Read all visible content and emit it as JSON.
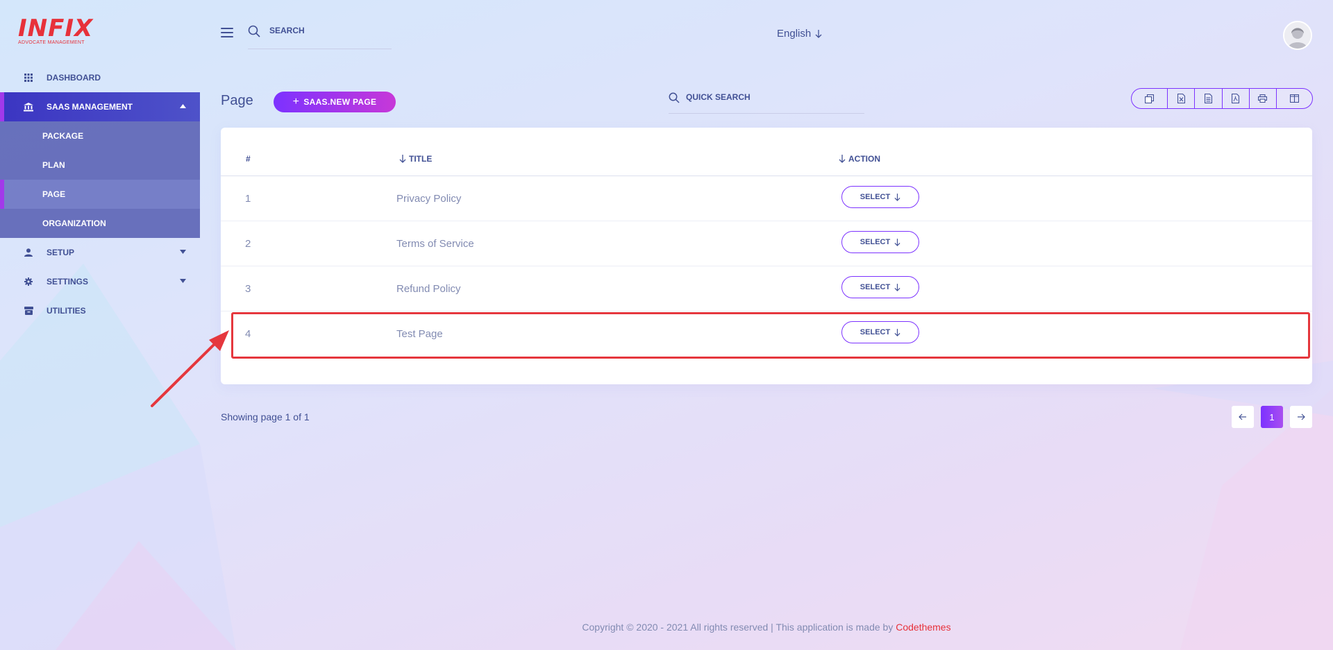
{
  "brand": {
    "logo_text": "INFIX",
    "logo_subtitle": "ADVOCATE MANAGEMENT"
  },
  "sidebar": {
    "items": [
      {
        "label": "DASHBOARD",
        "icon": "grid-icon"
      },
      {
        "label": "SAAS MANAGEMENT",
        "icon": "bank-icon",
        "expanded": true,
        "children": [
          {
            "label": "PACKAGE"
          },
          {
            "label": "PLAN"
          },
          {
            "label": "PAGE",
            "current": true
          },
          {
            "label": "ORGANIZATION"
          }
        ]
      },
      {
        "label": "SETUP",
        "icon": "user-icon"
      },
      {
        "label": "SETTINGS",
        "icon": "gear-icon"
      },
      {
        "label": "UTILITIES",
        "icon": "archive-icon"
      }
    ]
  },
  "header": {
    "search_placeholder": "SEARCH",
    "language": "English"
  },
  "page": {
    "title": "Page",
    "new_button_label": "SAAS.NEW PAGE",
    "quick_search_placeholder": "QUICK SEARCH",
    "export_buttons": [
      "copy-icon",
      "excel-icon",
      "csv-icon",
      "pdf-icon",
      "print-icon",
      "columns-icon"
    ]
  },
  "table": {
    "columns": [
      "#",
      "TITLE",
      "ACTION"
    ],
    "rows": [
      {
        "num": "1",
        "title": "Privacy Policy",
        "action": "SELECT"
      },
      {
        "num": "2",
        "title": "Terms of Service",
        "action": "SELECT"
      },
      {
        "num": "3",
        "title": "Refund Policy",
        "action": "SELECT"
      },
      {
        "num": "4",
        "title": "Test Page",
        "action": "SELECT"
      }
    ]
  },
  "pagination": {
    "summary": "Showing page 1 of 1",
    "current": "1"
  },
  "footer": {
    "copyright": "Copyright © 2020 - 2021 All rights reserved | This application is made by ",
    "brand": "Codethemes"
  },
  "colors": {
    "accent": "#7c32ff",
    "accent_end": "#c738d8",
    "text": "#415094",
    "muted": "#828bb2",
    "highlight": "#e5373d"
  }
}
